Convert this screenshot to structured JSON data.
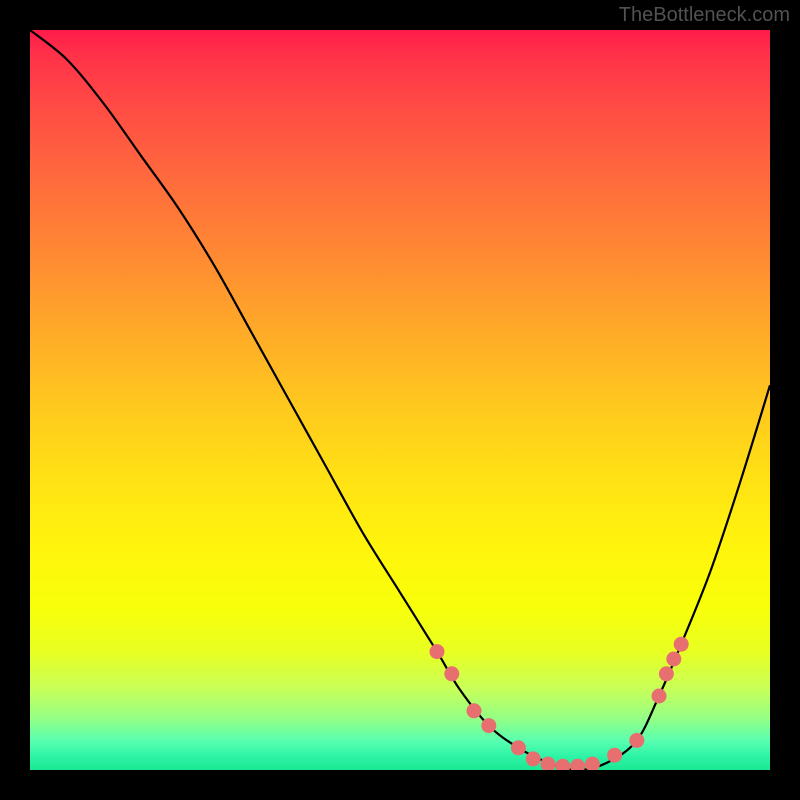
{
  "watermark": "TheBottleneck.com",
  "chart_data": {
    "type": "line",
    "title": "",
    "xlabel": "",
    "ylabel": "",
    "xlim": [
      0,
      100
    ],
    "ylim": [
      0,
      100
    ],
    "gradient_meaning": "background vertical gradient red (top=high bottleneck) to green (bottom=low bottleneck)",
    "series": [
      {
        "name": "bottleneck-curve",
        "x": [
          0,
          5,
          10,
          15,
          20,
          25,
          30,
          35,
          40,
          45,
          50,
          55,
          58,
          62,
          66,
          70,
          74,
          78,
          82,
          85,
          88,
          92,
          96,
          100
        ],
        "y": [
          100,
          96,
          90,
          83,
          76,
          68,
          59,
          50,
          41,
          32,
          24,
          16,
          11,
          6,
          3,
          1,
          0,
          1,
          4,
          10,
          17,
          27,
          39,
          52
        ]
      }
    ],
    "markers": {
      "comment": "Highlighted points near trough, salmon/pink circles",
      "color": "#e76f6f",
      "x": [
        55,
        57,
        60,
        62,
        66,
        68,
        70,
        72,
        74,
        76,
        79,
        82,
        85,
        86,
        87,
        88
      ],
      "y": [
        16,
        13,
        8,
        6,
        3,
        1.5,
        0.8,
        0.5,
        0.5,
        0.8,
        2,
        4,
        10,
        13,
        15,
        17
      ]
    }
  }
}
